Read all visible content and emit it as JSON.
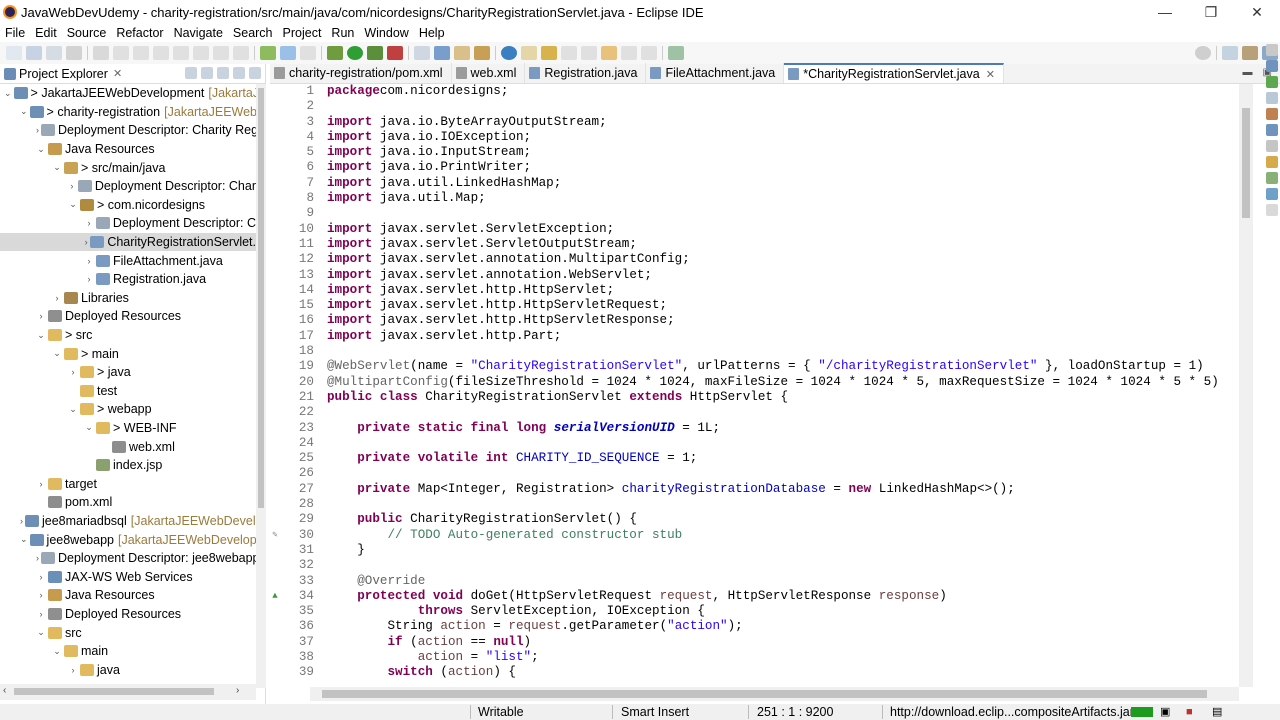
{
  "window": {
    "title": "JavaWebDevUdemy - charity-registration/src/main/java/com/nicordesigns/CharityRegistrationServlet.java - Eclipse IDE",
    "minimize": "—",
    "maximize": "❐",
    "close": "✕"
  },
  "menu": [
    "File",
    "Edit",
    "Source",
    "Refactor",
    "Navigate",
    "Search",
    "Project",
    "Run",
    "Window",
    "Help"
  ],
  "explorer": {
    "title": "Project Explorer",
    "close": "✕",
    "items": [
      {
        "label": "> JakartaJEEWebDevelopment",
        "decoration": "[JakartaJEE",
        "arrow": "⌄",
        "icon": "project",
        "indent": 0
      },
      {
        "label": "> charity-registration",
        "decoration": "[JakartaJEEWebD",
        "arrow": "⌄",
        "icon": "project",
        "indent": 1
      },
      {
        "label": "Deployment Descriptor: Charity Reg",
        "decoration": "",
        "arrow": "›",
        "icon": "dd",
        "indent": 2
      },
      {
        "label": "Java Resources",
        "decoration": "",
        "arrow": "⌄",
        "icon": "jr",
        "indent": 2
      },
      {
        "label": "> src/main/java",
        "decoration": "",
        "arrow": "⌄",
        "icon": "pkgroot",
        "indent": 3
      },
      {
        "label": "Deployment Descriptor: Char",
        "decoration": "",
        "arrow": "›",
        "icon": "dd",
        "indent": 4
      },
      {
        "label": "> com.nicordesigns",
        "decoration": "",
        "arrow": "⌄",
        "icon": "pkg",
        "indent": 4
      },
      {
        "label": "Deployment Descriptor: C",
        "decoration": "",
        "arrow": "›",
        "icon": "dd",
        "indent": 5
      },
      {
        "label": "CharityRegistrationServlet.",
        "decoration": "",
        "arrow": "›",
        "icon": "java",
        "indent": 5,
        "selected": true
      },
      {
        "label": "FileAttachment.java",
        "decoration": "",
        "arrow": "›",
        "icon": "java",
        "indent": 5
      },
      {
        "label": "Registration.java",
        "decoration": "",
        "arrow": "›",
        "icon": "java",
        "indent": 5
      },
      {
        "label": "Libraries",
        "decoration": "",
        "arrow": "›",
        "icon": "lib",
        "indent": 3
      },
      {
        "label": "Deployed Resources",
        "decoration": "",
        "arrow": "›",
        "icon": "dr",
        "indent": 2
      },
      {
        "label": "> src",
        "decoration": "",
        "arrow": "⌄",
        "icon": "folder",
        "indent": 2
      },
      {
        "label": "> main",
        "decoration": "",
        "arrow": "⌄",
        "icon": "folder",
        "indent": 3
      },
      {
        "label": "> java",
        "decoration": "",
        "arrow": "›",
        "icon": "folder",
        "indent": 4
      },
      {
        "label": "test",
        "decoration": "",
        "arrow": "",
        "icon": "folder",
        "indent": 4
      },
      {
        "label": "> webapp",
        "decoration": "",
        "arrow": "⌄",
        "icon": "folder",
        "indent": 4
      },
      {
        "label": "> WEB-INF",
        "decoration": "",
        "arrow": "⌄",
        "icon": "folder",
        "indent": 5
      },
      {
        "label": "web.xml",
        "decoration": "",
        "arrow": "",
        "icon": "xml",
        "indent": 6
      },
      {
        "label": "index.jsp",
        "decoration": "",
        "arrow": "",
        "icon": "jsp",
        "indent": 5
      },
      {
        "label": "target",
        "decoration": "",
        "arrow": "›",
        "icon": "folder",
        "indent": 2
      },
      {
        "label": "pom.xml",
        "decoration": "",
        "arrow": "",
        "icon": "xml",
        "indent": 2
      },
      {
        "label": "jee8mariadbsql",
        "decoration": "[JakartaJEEWebDevelo",
        "arrow": "›",
        "icon": "project",
        "indent": 1
      },
      {
        "label": "jee8webapp",
        "decoration": "[JakartaJEEWebDevelopm",
        "arrow": "⌄",
        "icon": "project",
        "indent": 1
      },
      {
        "label": "Deployment Descriptor: jee8webapp",
        "decoration": "",
        "arrow": "›",
        "icon": "dd",
        "indent": 2
      },
      {
        "label": "JAX-WS Web Services",
        "decoration": "",
        "arrow": "›",
        "icon": "ws",
        "indent": 2
      },
      {
        "label": "Java Resources",
        "decoration": "",
        "arrow": "›",
        "icon": "jr",
        "indent": 2
      },
      {
        "label": "Deployed Resources",
        "decoration": "",
        "arrow": "›",
        "icon": "dr",
        "indent": 2
      },
      {
        "label": "src",
        "decoration": "",
        "arrow": "⌄",
        "icon": "folder",
        "indent": 2
      },
      {
        "label": "main",
        "decoration": "",
        "arrow": "⌄",
        "icon": "folder",
        "indent": 3
      },
      {
        "label": "java",
        "decoration": "",
        "arrow": "›",
        "icon": "folder",
        "indent": 4
      }
    ]
  },
  "editor": {
    "tabs": [
      {
        "label": "charity-registration/pom.xml",
        "icon": "xml",
        "active": false
      },
      {
        "label": "web.xml",
        "icon": "xml",
        "active": false
      },
      {
        "label": "Registration.java",
        "icon": "java",
        "active": false
      },
      {
        "label": "FileAttachment.java",
        "icon": "java",
        "active": false
      },
      {
        "label": "*CharityRegistrationServlet.java",
        "icon": "java",
        "active": true
      }
    ],
    "tab_close": "✕",
    "lines": [
      {
        "n": "1",
        "t": [
          [
            "kw",
            "package"
          ],
          [
            "",
            "com.nicordesigns;"
          ]
        ]
      },
      {
        "n": "2",
        "t": []
      },
      {
        "n": "3",
        "fold": "⊖",
        "t": [
          [
            "kw",
            "import"
          ],
          [
            "",
            " java.io.ByteArrayOutputStream;"
          ]
        ]
      },
      {
        "n": "4",
        "t": [
          [
            "kw",
            "import"
          ],
          [
            "",
            " java.io.IOException;"
          ]
        ]
      },
      {
        "n": "5",
        "t": [
          [
            "kw",
            "import"
          ],
          [
            "",
            " java.io.InputStream;"
          ]
        ]
      },
      {
        "n": "6",
        "t": [
          [
            "kw",
            "import"
          ],
          [
            "",
            " java.io.PrintWriter;"
          ]
        ]
      },
      {
        "n": "7",
        "t": [
          [
            "kw",
            "import"
          ],
          [
            "",
            " java.util.LinkedHashMap;"
          ]
        ]
      },
      {
        "n": "8",
        "t": [
          [
            "kw",
            "import"
          ],
          [
            "",
            " java.util.Map;"
          ]
        ]
      },
      {
        "n": "9",
        "t": []
      },
      {
        "n": "10",
        "t": [
          [
            "kw",
            "import"
          ],
          [
            "",
            " javax.servlet.ServletException;"
          ]
        ]
      },
      {
        "n": "11",
        "t": [
          [
            "kw",
            "import"
          ],
          [
            "",
            " javax.servlet.ServletOutputStream;"
          ]
        ]
      },
      {
        "n": "12",
        "t": [
          [
            "kw",
            "import"
          ],
          [
            "",
            " javax.servlet.annotation.MultipartConfig;"
          ]
        ]
      },
      {
        "n": "13",
        "t": [
          [
            "kw",
            "import"
          ],
          [
            "",
            " javax.servlet.annotation.WebServlet;"
          ]
        ]
      },
      {
        "n": "14",
        "t": [
          [
            "kw",
            "import"
          ],
          [
            "",
            " javax.servlet.http.HttpServlet;"
          ]
        ]
      },
      {
        "n": "15",
        "t": [
          [
            "kw",
            "import"
          ],
          [
            "",
            " javax.servlet.http.HttpServletRequest;"
          ]
        ]
      },
      {
        "n": "16",
        "t": [
          [
            "kw",
            "import"
          ],
          [
            "",
            " javax.servlet.http.HttpServletResponse;"
          ]
        ]
      },
      {
        "n": "17",
        "t": [
          [
            "kw",
            "import"
          ],
          [
            "",
            " javax.servlet.http.Part;"
          ]
        ]
      },
      {
        "n": "18",
        "t": []
      },
      {
        "n": "19",
        "t": [
          [
            "ann",
            "@WebServlet"
          ],
          [
            "",
            "(name = "
          ],
          [
            "str",
            "\"CharityRegistrationServlet\""
          ],
          [
            "",
            ", urlPatterns = { "
          ],
          [
            "str",
            "\"/charityRegistrationServlet\""
          ],
          [
            "",
            " }, loadOnStartup = 1)"
          ]
        ]
      },
      {
        "n": "20",
        "t": [
          [
            "ann",
            "@MultipartConfig"
          ],
          [
            "",
            "(fileSizeThreshold = 1024 * 1024, maxFileSize = 1024 * 1024 * 5, maxRequestSize = 1024 * 1024 * 5 * 5)"
          ]
        ]
      },
      {
        "n": "21",
        "t": [
          [
            "kw",
            "public"
          ],
          [
            "",
            " "
          ],
          [
            "kw",
            "class"
          ],
          [
            "",
            " CharityRegistrationServlet "
          ],
          [
            "kw",
            "extends"
          ],
          [
            "",
            " HttpServlet {"
          ]
        ]
      },
      {
        "n": "22",
        "t": []
      },
      {
        "n": "23",
        "t": [
          [
            "",
            "    "
          ],
          [
            "kw",
            "private"
          ],
          [
            "",
            " "
          ],
          [
            "kw",
            "static"
          ],
          [
            "",
            " "
          ],
          [
            "kw",
            "final"
          ],
          [
            "",
            " "
          ],
          [
            "kw",
            "long"
          ],
          [
            "",
            " "
          ],
          [
            "sfld",
            "serialVersionUID"
          ],
          [
            "",
            " = 1L;"
          ]
        ]
      },
      {
        "n": "24",
        "t": []
      },
      {
        "n": "25",
        "t": [
          [
            "",
            "    "
          ],
          [
            "kw",
            "private"
          ],
          [
            "",
            " "
          ],
          [
            "kw",
            "volatile"
          ],
          [
            "",
            " "
          ],
          [
            "kw",
            "int"
          ],
          [
            "",
            " "
          ],
          [
            "fld",
            "CHARITY_ID_SEQUENCE"
          ],
          [
            "",
            " = 1;"
          ]
        ]
      },
      {
        "n": "26",
        "t": []
      },
      {
        "n": "27",
        "t": [
          [
            "",
            "    "
          ],
          [
            "kw",
            "private"
          ],
          [
            "",
            " Map<Integer, Registration> "
          ],
          [
            "fld",
            "charityRegistrationDatabase"
          ],
          [
            "",
            " = "
          ],
          [
            "kw",
            "new"
          ],
          [
            "",
            " LinkedHashMap<>();"
          ]
        ]
      },
      {
        "n": "28",
        "t": []
      },
      {
        "n": "29",
        "fold": "⊖",
        "t": [
          [
            "",
            "    "
          ],
          [
            "kw",
            "public"
          ],
          [
            "",
            " CharityRegistrationServlet() {"
          ]
        ]
      },
      {
        "n": "30",
        "mark": "✎",
        "t": [
          [
            "",
            "        "
          ],
          [
            "cmt",
            "// TODO Auto-generated constructor stub"
          ]
        ]
      },
      {
        "n": "31",
        "t": [
          [
            "",
            "    }"
          ]
        ]
      },
      {
        "n": "32",
        "t": []
      },
      {
        "n": "33",
        "fold": "⊖",
        "t": [
          [
            "",
            "    "
          ],
          [
            "ann",
            "@Override"
          ]
        ]
      },
      {
        "n": "34",
        "mark": "▲",
        "t": [
          [
            "",
            "    "
          ],
          [
            "kw",
            "protected"
          ],
          [
            "",
            " "
          ],
          [
            "kw",
            "void"
          ],
          [
            "",
            " doGet(HttpServletRequest "
          ],
          [
            "par",
            "request"
          ],
          [
            "",
            ", HttpServletResponse "
          ],
          [
            "par",
            "response"
          ],
          [
            "",
            ")"
          ]
        ]
      },
      {
        "n": "35",
        "t": [
          [
            "",
            "            "
          ],
          [
            "kw",
            "throws"
          ],
          [
            "",
            " ServletException, IOException {"
          ]
        ]
      },
      {
        "n": "36",
        "t": [
          [
            "",
            "        String "
          ],
          [
            "par",
            "action"
          ],
          [
            "",
            " = "
          ],
          [
            "par",
            "request"
          ],
          [
            "",
            ".getParameter("
          ],
          [
            "str",
            "\"action\""
          ],
          [
            "",
            ");"
          ]
        ]
      },
      {
        "n": "37",
        "t": [
          [
            "",
            "        "
          ],
          [
            "kw",
            "if"
          ],
          [
            "",
            " ("
          ],
          [
            "par",
            "action"
          ],
          [
            "",
            " == "
          ],
          [
            "kw",
            "null"
          ],
          [
            "",
            ")"
          ]
        ]
      },
      {
        "n": "38",
        "t": [
          [
            "",
            "            "
          ],
          [
            "par",
            "action"
          ],
          [
            "",
            " = "
          ],
          [
            "str",
            "\"list\""
          ],
          [
            "",
            ";"
          ]
        ]
      },
      {
        "n": "39",
        "t": [
          [
            "",
            "        "
          ],
          [
            "kw",
            "switch"
          ],
          [
            "",
            " ("
          ],
          [
            "par",
            "action"
          ],
          [
            "",
            ") {"
          ]
        ]
      }
    ]
  },
  "status": {
    "mode": "Writable",
    "insert": "Smart Insert",
    "position": "251 : 1 : 9200",
    "url": "http://download.eclip...compositeArtifacts.jar"
  }
}
